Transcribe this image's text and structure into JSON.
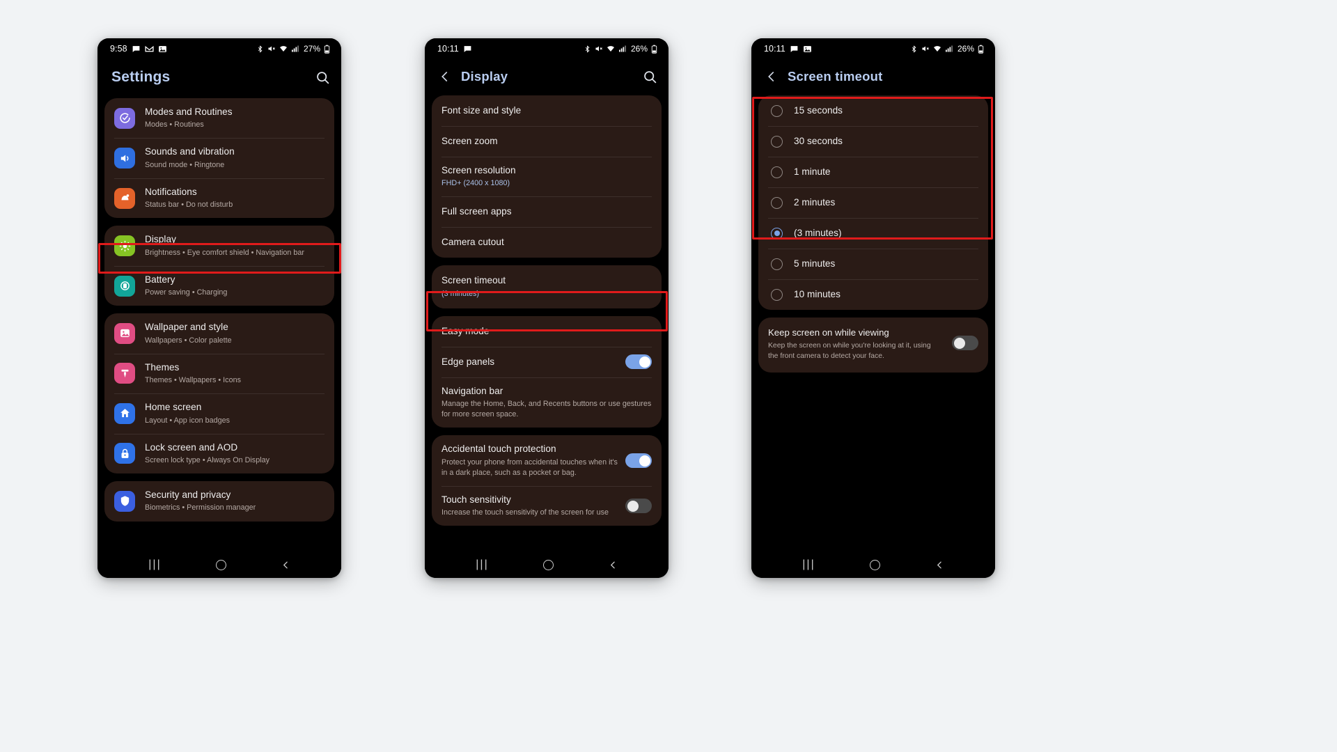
{
  "annotations": {
    "color": "#e01b1b",
    "boxes": [
      "display-row",
      "screen-timeout-row",
      "timeout-options-group"
    ]
  },
  "phone1": {
    "status_bar": {
      "time": "9:58",
      "battery_percent": "27%",
      "left_icons": [
        "message-icon",
        "gmail-icon",
        "photos-icon"
      ],
      "right_icons": [
        "bluetooth-icon",
        "mute-icon",
        "wifi-icon",
        "signal-icon",
        "battery-icon"
      ]
    },
    "app_bar": {
      "title": "Settings",
      "search_icon": "search-icon"
    },
    "groups": [
      {
        "items": [
          {
            "title": "Modes and Routines",
            "subtitle": "Modes • Routines",
            "icon": "modes-icon",
            "icon_color": "#7d6ce0"
          },
          {
            "title": "Sounds and vibration",
            "subtitle": "Sound mode • Ringtone",
            "icon": "sound-icon",
            "icon_color": "#2f6fe0"
          },
          {
            "title": "Notifications",
            "subtitle": "Status bar • Do not disturb",
            "icon": "notifications-icon",
            "icon_color": "#e4622a"
          }
        ]
      },
      {
        "items": [
          {
            "title": "Display",
            "subtitle": "Brightness • Eye comfort shield • Navigation bar",
            "icon": "display-icon",
            "icon_color": "#86c324",
            "highlighted": true
          },
          {
            "title": "Battery",
            "subtitle": "Power saving • Charging",
            "icon": "battery-settings-icon",
            "icon_color": "#12a699"
          }
        ]
      },
      {
        "items": [
          {
            "title": "Wallpaper and style",
            "subtitle": "Wallpapers • Color palette",
            "icon": "wallpaper-icon",
            "icon_color": "#e04d83"
          },
          {
            "title": "Themes",
            "subtitle": "Themes • Wallpapers • Icons",
            "icon": "themes-icon",
            "icon_color": "#e04d83"
          },
          {
            "title": "Home screen",
            "subtitle": "Layout • App icon badges",
            "icon": "home-screen-icon",
            "icon_color": "#2f72e8"
          },
          {
            "title": "Lock screen and AOD",
            "subtitle": "Screen lock type • Always On Display",
            "icon": "lock-icon",
            "icon_color": "#2f72e8"
          }
        ]
      },
      {
        "items": [
          {
            "title": "Security and privacy",
            "subtitle": "Biometrics • Permission manager",
            "icon": "security-icon",
            "icon_color": "#3b5fe0"
          }
        ]
      }
    ],
    "nav_bar": {
      "recents": "|||",
      "home": "home-circle-icon",
      "back": "back-chevron-icon"
    }
  },
  "phone2": {
    "status_bar": {
      "time": "10:11",
      "battery_percent": "26%",
      "left_icons": [
        "message-icon"
      ],
      "right_icons": [
        "bluetooth-icon",
        "mute-icon",
        "wifi-icon",
        "signal-icon",
        "battery-icon"
      ]
    },
    "app_bar": {
      "back_icon": "back-chevron-icon",
      "title": "Display",
      "search_icon": "search-icon"
    },
    "groups": [
      {
        "items": [
          {
            "title": "Font size and style"
          },
          {
            "title": "Screen zoom"
          },
          {
            "title": "Screen resolution",
            "subtitle": "FHD+ (2400 x 1080)",
            "subtitle_style": "blue"
          },
          {
            "title": "Full screen apps"
          },
          {
            "title": "Camera cutout"
          }
        ]
      },
      {
        "items": [
          {
            "title": "Screen timeout",
            "subtitle": "(3 minutes)",
            "subtitle_style": "blue",
            "highlighted": true
          }
        ]
      },
      {
        "items": [
          {
            "title": "Easy mode"
          },
          {
            "title": "Edge panels",
            "toggle": "on"
          },
          {
            "title": "Navigation bar",
            "subtitle": "Manage the Home, Back, and Recents buttons or use gestures for more screen space."
          }
        ]
      },
      {
        "items": [
          {
            "title": "Accidental touch protection",
            "subtitle": "Protect your phone from accidental touches when it's in a dark place, such as a pocket or bag.",
            "toggle": "on"
          },
          {
            "title": "Touch sensitivity",
            "subtitle": "Increase the touch sensitivity of the screen for use",
            "toggle": "off"
          }
        ]
      }
    ],
    "nav_bar": {
      "recents": "|||",
      "home": "home-circle-icon",
      "back": "back-chevron-icon"
    }
  },
  "phone3": {
    "status_bar": {
      "time": "10:11",
      "battery_percent": "26%",
      "left_icons": [
        "message-icon",
        "photos-icon"
      ],
      "right_icons": [
        "bluetooth-icon",
        "mute-icon",
        "wifi-icon",
        "signal-icon",
        "battery-icon"
      ]
    },
    "app_bar": {
      "back_icon": "back-chevron-icon",
      "title": "Screen timeout"
    },
    "options": [
      {
        "label": "15 seconds",
        "selected": false
      },
      {
        "label": "30 seconds",
        "selected": false
      },
      {
        "label": "1 minute",
        "selected": false
      },
      {
        "label": "2 minutes",
        "selected": false
      },
      {
        "label": "(3 minutes)",
        "selected": true
      },
      {
        "label": "5 minutes",
        "selected": false
      },
      {
        "label": "10 minutes",
        "selected": false
      }
    ],
    "keep_screen": {
      "title": "Keep screen on while viewing",
      "subtitle": "Keep the screen on while you're looking at it, using the front camera to detect your face.",
      "toggle": "off"
    },
    "nav_bar": {
      "recents": "|||",
      "home": "home-circle-icon",
      "back": "back-chevron-icon"
    }
  }
}
